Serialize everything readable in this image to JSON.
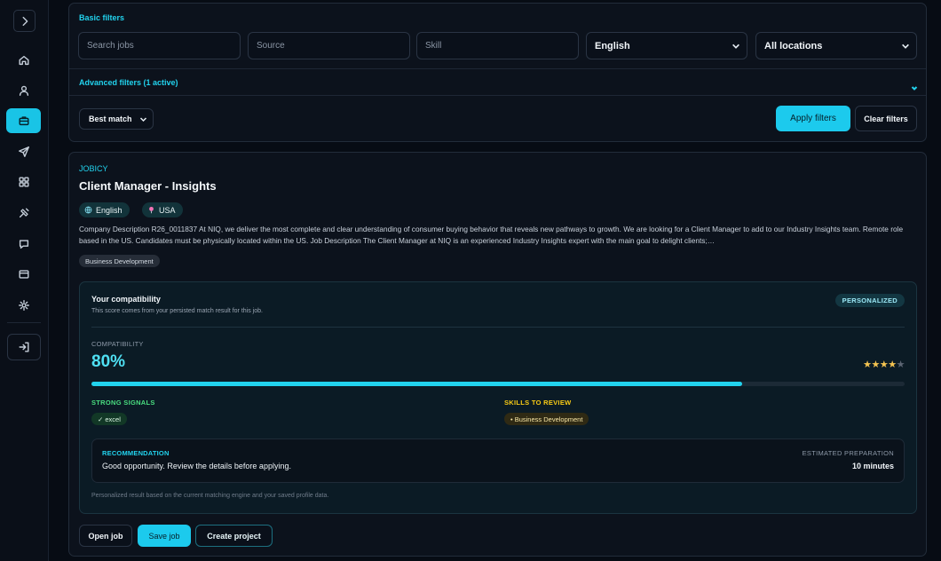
{
  "sidebar": {
    "items": [
      {
        "name": "home",
        "icon": "home-icon"
      },
      {
        "name": "profile",
        "icon": "user-icon"
      },
      {
        "name": "jobs",
        "icon": "briefcase-icon",
        "active": true
      },
      {
        "name": "applications",
        "icon": "send-icon"
      },
      {
        "name": "dashboard",
        "icon": "grid-icon"
      },
      {
        "name": "tools",
        "icon": "tools-icon"
      },
      {
        "name": "messages",
        "icon": "chat-icon"
      },
      {
        "name": "billing",
        "icon": "card-icon"
      },
      {
        "name": "settings",
        "icon": "gear-icon"
      }
    ]
  },
  "filters": {
    "section_title": "Basic filters",
    "search_placeholder": "Search jobs",
    "source_placeholder": "Source",
    "skill_placeholder": "Skill",
    "language_value": "English",
    "location_value": "All locations",
    "advanced_label": "Advanced filters (1 active)",
    "sort_value": "Best match",
    "apply_label": "Apply filters",
    "clear_label": "Clear filters"
  },
  "job": {
    "source": "JOBICY",
    "title": "Client Manager - Insights",
    "language": "English",
    "location": "USA",
    "description": "Company Description R26_0011837 At NIQ, we deliver the most complete and clear understanding of consumer buying behavior that reveals new pathways to growth. We are looking for a Client Manager to add to our Industry Insights team. Remote role based in the US. Candidates must be physically located within the US. Job Description The Client Manager at NIQ is an experienced Industry Insights expert with the main goal to delight clients;…",
    "tag": "Business Development",
    "compatibility": {
      "title": "Your compatibility",
      "subtitle": "This score comes from your persisted match result for this job.",
      "badge": "PERSONALIZED",
      "label": "COMPATIBILITY",
      "percent_text": "80%",
      "percent_value": 80,
      "stars_filled": 4,
      "stars_total": 5,
      "strong_signals_label": "STRONG SIGNALS",
      "strong_signal_item": "✓ excel",
      "skills_review_label": "SKILLS TO REVIEW",
      "skills_review_item": "• Business Development",
      "recommendation_label": "RECOMMENDATION",
      "recommendation_text": "Good opportunity. Review the details before applying.",
      "estimated_label": "ESTIMATED PREPARATION",
      "estimated_value": "10 minutes",
      "footnote": "Personalized result based on the current matching engine and your saved profile data."
    },
    "actions": {
      "open": "Open job",
      "save": "Save job",
      "project": "Create project"
    }
  },
  "colors": {
    "accent": "#22d3ee",
    "background": "#070c14",
    "panel": "#0c121c",
    "success": "#4ade80",
    "warning": "#facc15",
    "star": "#f5c451"
  }
}
